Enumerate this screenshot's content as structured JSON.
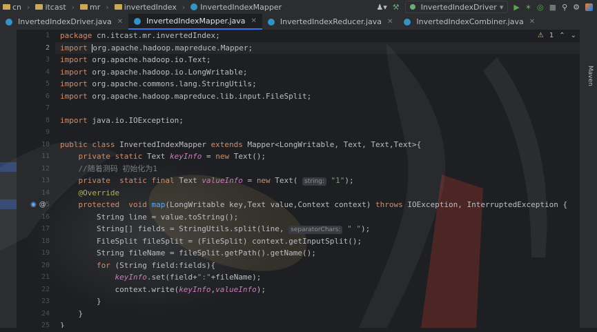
{
  "breadcrumbs": [
    "cn",
    "itcast",
    "mr",
    "invertedIndex",
    "InvertedIndexMapper"
  ],
  "toolbar": {
    "run_config": "InvertedIndexDriver",
    "icons": [
      "user-icon",
      "hammer-icon",
      "run-icon",
      "debug-icon",
      "coverage-icon",
      "stop-icon",
      "search-icon",
      "settings-icon",
      "logo-icon"
    ]
  },
  "tabs": [
    {
      "label": "InvertedIndexDriver.java",
      "active": false
    },
    {
      "label": "InvertedIndexMapper.java",
      "active": true
    },
    {
      "label": "InvertedIndexReducer.java",
      "active": false
    },
    {
      "label": "InvertedIndexCombiner.java",
      "active": false
    }
  ],
  "inspection": {
    "warnings": "1"
  },
  "right_tool": "Maven",
  "line_numbers": [
    "1",
    "2",
    "3",
    "4",
    "5",
    "6",
    "7",
    "8",
    "9",
    "10",
    "11",
    "12",
    "13",
    "14",
    "15",
    "16",
    "17",
    "18",
    "19",
    "20",
    "21",
    "22",
    "23",
    "24",
    "25"
  ],
  "current_line": "2",
  "code": [
    {
      "t": [
        {
          "c": "kw",
          "v": "package"
        },
        {
          "v": " cn.itcast.mr.invertedIndex;"
        }
      ]
    },
    {
      "t": [
        {
          "c": "kw",
          "v": "import"
        },
        {
          "v": " "
        },
        {
          "caret": true
        },
        {
          "v": "org.apache.hadoop.mapreduce.Mapper;"
        }
      ]
    },
    {
      "t": [
        {
          "c": "kw",
          "v": "import"
        },
        {
          "v": " org.apache.hadoop.io.Text;"
        }
      ]
    },
    {
      "t": [
        {
          "c": "kw",
          "v": "import"
        },
        {
          "v": " org.apache.hadoop.io.LongWritable;"
        }
      ]
    },
    {
      "t": [
        {
          "c": "kw",
          "v": "import"
        },
        {
          "v": " org.apache.commons.lang.StringUtils;"
        }
      ]
    },
    {
      "t": [
        {
          "c": "kw",
          "v": "import"
        },
        {
          "v": " org.apache.hadoop.mapreduce.lib.input.FileSplit;"
        }
      ]
    },
    {
      "t": []
    },
    {
      "t": [
        {
          "c": "kw",
          "v": "import"
        },
        {
          "v": " java.io.IOException;"
        }
      ]
    },
    {
      "t": []
    },
    {
      "t": [
        {
          "c": "kw",
          "v": "public class"
        },
        {
          "v": " InvertedIndexMapper "
        },
        {
          "c": "kw",
          "v": "extends"
        },
        {
          "v": " Mapper<LongWritable, Text, Text,Text>{"
        }
      ]
    },
    {
      "t": [
        {
          "v": "    "
        },
        {
          "c": "kw",
          "v": "private static"
        },
        {
          "v": " Text "
        },
        {
          "c": "fld",
          "v": "keyInfo"
        },
        {
          "v": " = "
        },
        {
          "c": "kw",
          "v": "new"
        },
        {
          "v": " Text();"
        }
      ]
    },
    {
      "t": [
        {
          "v": "    "
        },
        {
          "c": "cmt",
          "v": "//随着测码 初始化为1"
        }
      ]
    },
    {
      "t": [
        {
          "v": "    "
        },
        {
          "c": "kw",
          "v": "private  static final"
        },
        {
          "v": " Text "
        },
        {
          "c": "fld",
          "v": "valueInfo"
        },
        {
          "v": " = "
        },
        {
          "c": "kw",
          "v": "new"
        },
        {
          "v": " Text( "
        },
        {
          "hint": "string:"
        },
        {
          "v": " "
        },
        {
          "c": "str",
          "v": "\"1\""
        },
        {
          "v": ");"
        }
      ]
    },
    {
      "t": [
        {
          "v": "    "
        },
        {
          "c": "ann",
          "v": "@Override"
        }
      ]
    },
    {
      "t": [
        {
          "v": "    "
        },
        {
          "c": "kw",
          "v": "protected  void"
        },
        {
          "v": " "
        },
        {
          "c": "fn",
          "v": "map"
        },
        {
          "v": "(LongWritable key,Text value,Context context) "
        },
        {
          "c": "kw",
          "v": "throws"
        },
        {
          "v": " IOException, InterruptedException {"
        }
      ]
    },
    {
      "t": [
        {
          "v": "        String line = value.toString();"
        }
      ]
    },
    {
      "t": [
        {
          "v": "        String[] fields = StringUtils.split(line, "
        },
        {
          "hint": "separatorChars:"
        },
        {
          "v": " "
        },
        {
          "c": "str",
          "v": "\" \""
        },
        {
          "v": ");"
        }
      ]
    },
    {
      "t": [
        {
          "v": "        FileSplit fileSplit = (FileSplit) context.getInputSplit();"
        }
      ]
    },
    {
      "t": [
        {
          "v": "        String fileName = fileSplit.getPath().getName();"
        }
      ]
    },
    {
      "t": [
        {
          "v": "        "
        },
        {
          "c": "kw",
          "v": "for"
        },
        {
          "v": " (String field:fields){"
        }
      ]
    },
    {
      "t": [
        {
          "v": "            "
        },
        {
          "c": "fld",
          "v": "keyInfo"
        },
        {
          "v": ".set(field+"
        },
        {
          "c": "str",
          "v": "\":\""
        },
        {
          "v": "+fileName);"
        }
      ]
    },
    {
      "t": [
        {
          "v": "            context.write("
        },
        {
          "c": "fld",
          "v": "keyInfo"
        },
        {
          "v": ","
        },
        {
          "c": "fld",
          "v": "valueInfo"
        },
        {
          "v": ");"
        }
      ]
    },
    {
      "t": [
        {
          "v": "        }"
        }
      ]
    },
    {
      "t": [
        {
          "v": "    }"
        }
      ]
    },
    {
      "t": [
        {
          "v": "}"
        }
      ]
    }
  ],
  "colors": {
    "background": "#1e1f22",
    "keyword": "#cf8e6d",
    "string": "#6aab73",
    "field": "#c77dbb",
    "annotation": "#b3ae60",
    "accent": "#3574f0"
  }
}
